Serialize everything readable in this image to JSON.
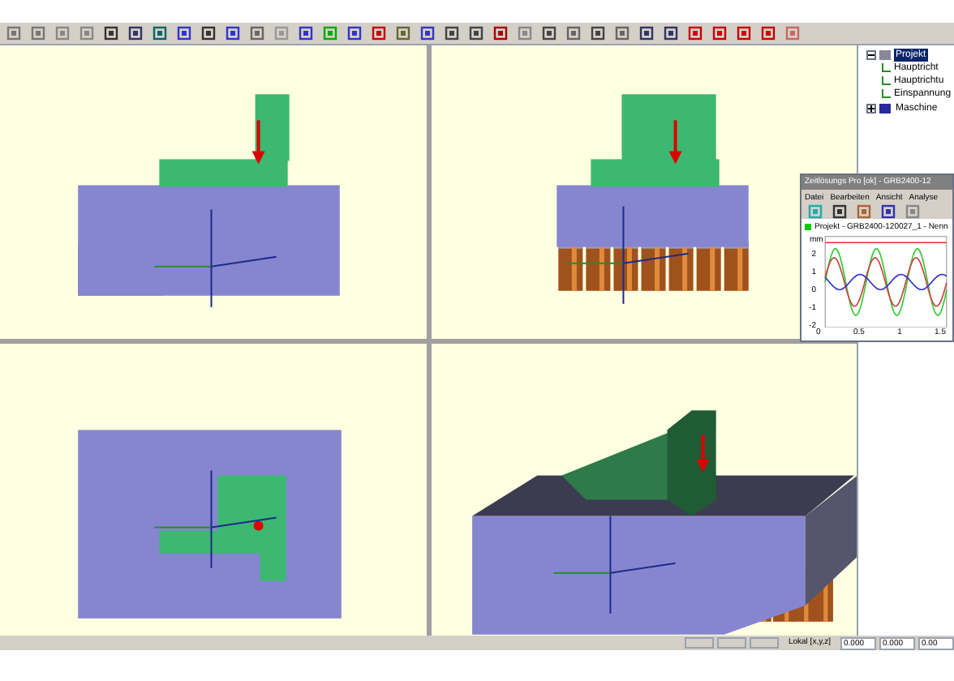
{
  "viewports": [
    {
      "kind": "front"
    },
    {
      "kind": "side"
    },
    {
      "kind": "top"
    },
    {
      "kind": "iso"
    }
  ],
  "tree": [
    {
      "label": "Projekt",
      "selected": true,
      "expanded": true,
      "children": [
        {
          "label": "Hauptricht",
          "selected": false
        },
        {
          "label": "Hauptrichtu",
          "selected": false
        },
        {
          "label": "Einspannung",
          "selected": false
        }
      ]
    },
    {
      "label": "Maschine",
      "selected": false,
      "expanded": false
    }
  ],
  "plot_window": {
    "title": "Zeitlösungs Pro [ok] - GRB2400-12",
    "menu": [
      "Datei",
      "Bearbeiten",
      "Ansicht",
      "Analyse"
    ],
    "tab": "Projekt - GRB2400-120027_1 - Nenn",
    "unit": "mm",
    "yticks": [
      "2",
      "1",
      "0",
      "-1",
      "-2"
    ],
    "xticks": [
      "0",
      "0.5",
      "1",
      "1.5"
    ]
  },
  "status_bar": {
    "label": "Lokal [x,y,z]",
    "values": [
      "0.000",
      "0.000",
      "0.00"
    ]
  }
}
